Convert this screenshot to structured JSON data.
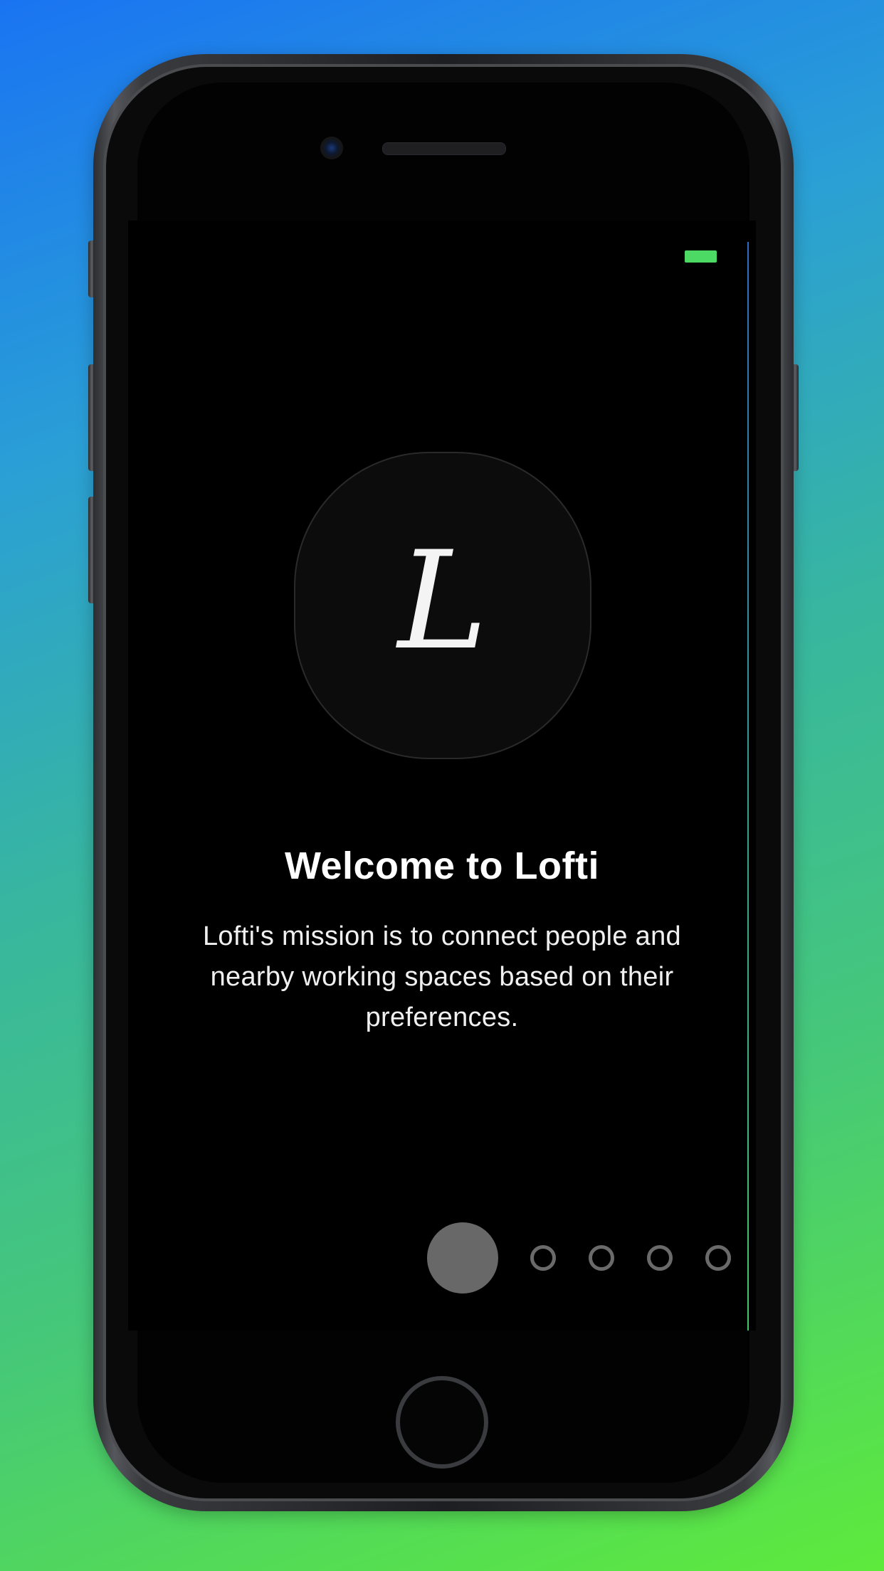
{
  "onboarding": {
    "logo_letter": "L",
    "title": "Welcome to Lofti",
    "description": "Lofti's mission is to connect people and nearby working spaces based on their preferences."
  },
  "pagination": {
    "total_pages": 5,
    "current_page": 1
  },
  "status_bar": {
    "battery_color": "#4cd964"
  },
  "colors": {
    "background_top": "#1a74f2",
    "background_bottom": "#5eea3c",
    "screen_background": "#000000",
    "active_dot": "#686868"
  }
}
